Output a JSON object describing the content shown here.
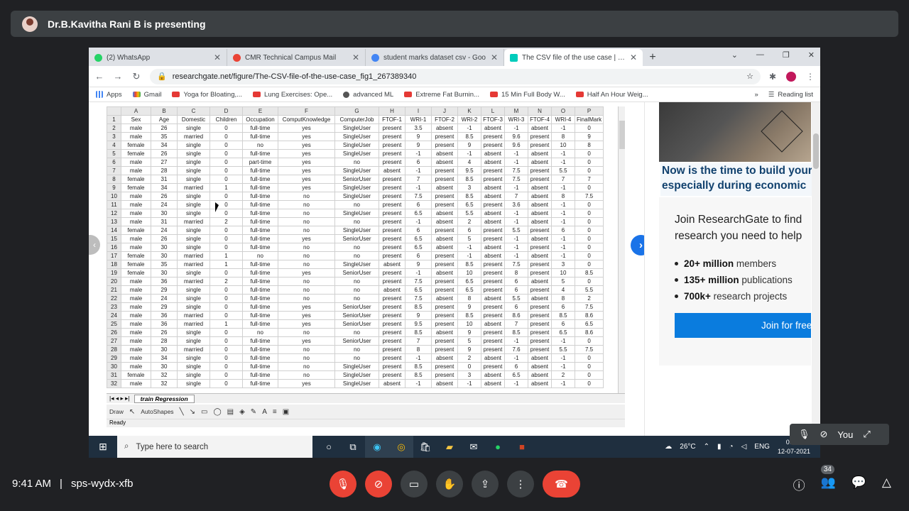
{
  "meet": {
    "presenter_label": "Dr.B.Kavitha Rani B is presenting",
    "time": "9:41 AM",
    "separator": "|",
    "meeting_code": "sps-wydx-xfb",
    "self_label": "You",
    "participants_count": "34"
  },
  "browser": {
    "tabs": [
      {
        "label": "(2) WhatsApp",
        "color": "#25d366"
      },
      {
        "label": "CMR Technical Campus Mail",
        "color": "#ea4335"
      },
      {
        "label": "student marks dataset csv - Goo",
        "color": "#4285f4"
      },
      {
        "label": "The CSV file of the use case | Da",
        "color": "#00ccbb"
      }
    ],
    "url": "researchgate.net/figure/The-CSV-file-of-the-use-case_fig1_267389340",
    "bookmarks": [
      "Apps",
      "Gmail",
      "Yoga for Bloating,...",
      "Lung Exercises: Ope...",
      "advanced ML",
      "Extreme Fat Burnin...",
      "15 Min Full Body W...",
      "Half An Hour Weig..."
    ],
    "reading_list": "Reading list",
    "more": "»"
  },
  "sheet": {
    "columns": [
      "",
      "A",
      "B",
      "C",
      "D",
      "E",
      "F",
      "G",
      "H",
      "I",
      "J",
      "K",
      "L",
      "M",
      "N",
      "O",
      "P"
    ],
    "rows": [
      [
        "1",
        "Sex",
        "Age",
        "Domestic",
        "Children",
        "Occupation",
        "ComputKnowledge",
        "ComputerJob",
        "FTOF-1",
        "WRI-1",
        "FTOF-2",
        "WRI-2",
        "FTOF-3",
        "WRI-3",
        "FTOF-4",
        "WRI-4",
        "FinalMark"
      ],
      [
        "2",
        "male",
        "26",
        "single",
        "0",
        "full-time",
        "yes",
        "SingleUser",
        "present",
        "3.5",
        "absent",
        "-1",
        "absent",
        "-1",
        "absent",
        "-1",
        "0"
      ],
      [
        "3",
        "male",
        "35",
        "married",
        "0",
        "full-time",
        "yes",
        "SingleUser",
        "present",
        "9",
        "present",
        "8.5",
        "present",
        "9.6",
        "present",
        "8",
        "9"
      ],
      [
        "4",
        "female",
        "34",
        "single",
        "0",
        "no",
        "yes",
        "SingleUser",
        "present",
        "9",
        "present",
        "9",
        "present",
        "9.6",
        "present",
        "10",
        "8"
      ],
      [
        "5",
        "female",
        "26",
        "single",
        "0",
        "full-time",
        "yes",
        "SingleUser",
        "present",
        "-1",
        "absent",
        "-1",
        "absent",
        "-1",
        "absent",
        "-1",
        "0"
      ],
      [
        "6",
        "male",
        "27",
        "single",
        "0",
        "part-time",
        "yes",
        "no",
        "present",
        "6",
        "absent",
        "4",
        "absent",
        "-1",
        "absent",
        "-1",
        "0"
      ],
      [
        "7",
        "male",
        "28",
        "single",
        "0",
        "full-time",
        "yes",
        "SingleUser",
        "absent",
        "-1",
        "present",
        "9.5",
        "present",
        "7.5",
        "present",
        "5.5",
        "0"
      ],
      [
        "8",
        "female",
        "31",
        "single",
        "0",
        "full-time",
        "yes",
        "SeniorUser",
        "present",
        "7",
        "present",
        "8.5",
        "present",
        "7.5",
        "present",
        "7",
        "7"
      ],
      [
        "9",
        "female",
        "34",
        "married",
        "1",
        "full-time",
        "yes",
        "SingleUser",
        "present",
        "-1",
        "absent",
        "3",
        "absent",
        "-1",
        "absent",
        "-1",
        "0"
      ],
      [
        "10",
        "male",
        "26",
        "single",
        "0",
        "full-time",
        "no",
        "SingleUser",
        "present",
        "7.5",
        "present",
        "8.5",
        "absent",
        "7",
        "absent",
        "8",
        "7.5"
      ],
      [
        "11",
        "male",
        "24",
        "single",
        "0",
        "full-time",
        "no",
        "no",
        "present",
        "6",
        "present",
        "6.5",
        "present",
        "3.6",
        "absent",
        "-1",
        "0"
      ],
      [
        "12",
        "male",
        "30",
        "single",
        "0",
        "full-time",
        "no",
        "SingleUser",
        "present",
        "6.5",
        "absent",
        "5.5",
        "absent",
        "-1",
        "absent",
        "-1",
        "0"
      ],
      [
        "13",
        "male",
        "31",
        "married",
        "2",
        "full-time",
        "no",
        "no",
        "present",
        "-1",
        "absent",
        "2",
        "absent",
        "-1",
        "absent",
        "-1",
        "0"
      ],
      [
        "14",
        "female",
        "24",
        "single",
        "0",
        "full-time",
        "no",
        "SingleUser",
        "present",
        "6",
        "present",
        "6",
        "present",
        "5.5",
        "present",
        "6",
        "0"
      ],
      [
        "15",
        "male",
        "26",
        "single",
        "0",
        "full-time",
        "yes",
        "SeniorUser",
        "present",
        "6.5",
        "absent",
        "5",
        "present",
        "-1",
        "absent",
        "-1",
        "0"
      ],
      [
        "16",
        "male",
        "30",
        "single",
        "0",
        "full-time",
        "no",
        "no",
        "present",
        "6.5",
        "absent",
        "-1",
        "absent",
        "-1",
        "present",
        "-1",
        "0"
      ],
      [
        "17",
        "female",
        "30",
        "married",
        "1",
        "no",
        "no",
        "no",
        "present",
        "6",
        "present",
        "-1",
        "absent",
        "-1",
        "absent",
        "-1",
        "0"
      ],
      [
        "18",
        "female",
        "35",
        "married",
        "1",
        "full-time",
        "no",
        "SingleUser",
        "absent",
        "9",
        "present",
        "8.5",
        "present",
        "7.5",
        "present",
        "3",
        "0"
      ],
      [
        "19",
        "female",
        "30",
        "single",
        "0",
        "full-time",
        "yes",
        "SeniorUser",
        "present",
        "-1",
        "absent",
        "10",
        "present",
        "8",
        "present",
        "10",
        "8.5"
      ],
      [
        "20",
        "male",
        "36",
        "married",
        "2",
        "full-time",
        "no",
        "no",
        "present",
        "7.5",
        "present",
        "6.5",
        "present",
        "6",
        "absent",
        "5",
        "0"
      ],
      [
        "21",
        "male",
        "29",
        "single",
        "0",
        "full-time",
        "no",
        "no",
        "absent",
        "6.5",
        "present",
        "6.5",
        "present",
        "6",
        "present",
        "4",
        "5.5"
      ],
      [
        "22",
        "male",
        "24",
        "single",
        "0",
        "full-time",
        "no",
        "no",
        "present",
        "7.5",
        "absent",
        "8",
        "absent",
        "5.5",
        "absent",
        "8",
        "2"
      ],
      [
        "23",
        "male",
        "29",
        "single",
        "0",
        "full-time",
        "yes",
        "SeniorUser",
        "present",
        "8.5",
        "present",
        "9",
        "present",
        "6",
        "present",
        "6",
        "7.5"
      ],
      [
        "24",
        "male",
        "36",
        "married",
        "0",
        "full-time",
        "yes",
        "SeniorUser",
        "present",
        "9",
        "present",
        "8.5",
        "present",
        "8.6",
        "present",
        "8.5",
        "8.6"
      ],
      [
        "25",
        "male",
        "36",
        "married",
        "1",
        "full-time",
        "yes",
        "SeniorUser",
        "present",
        "9.5",
        "present",
        "10",
        "absent",
        "7",
        "present",
        "6",
        "6.5"
      ],
      [
        "26",
        "male",
        "26",
        "single",
        "0",
        "no",
        "no",
        "no",
        "present",
        "8.5",
        "absent",
        "9",
        "present",
        "8.5",
        "present",
        "6.5",
        "8.6"
      ],
      [
        "27",
        "male",
        "28",
        "single",
        "0",
        "full-time",
        "yes",
        "SeniorUser",
        "present",
        "7",
        "present",
        "5",
        "present",
        "-1",
        "present",
        "-1",
        "0"
      ],
      [
        "28",
        "male",
        "30",
        "married",
        "0",
        "full-time",
        "no",
        "no",
        "present",
        "8",
        "present",
        "9",
        "present",
        "7.6",
        "present",
        "5.5",
        "7.5"
      ],
      [
        "29",
        "male",
        "34",
        "single",
        "0",
        "full-time",
        "no",
        "no",
        "present",
        "-1",
        "absent",
        "2",
        "absent",
        "-1",
        "absent",
        "-1",
        "0"
      ],
      [
        "30",
        "male",
        "30",
        "single",
        "0",
        "full-time",
        "no",
        "SingleUser",
        "present",
        "8.5",
        "present",
        "0",
        "present",
        "6",
        "absent",
        "-1",
        "0"
      ],
      [
        "31",
        "female",
        "32",
        "single",
        "0",
        "full-time",
        "no",
        "SingleUser",
        "present",
        "8.5",
        "present",
        "3",
        "absent",
        "6.5",
        "absent",
        "2",
        "0"
      ],
      [
        "32",
        "male",
        "32",
        "single",
        "0",
        "full-time",
        "yes",
        "SingleUser",
        "absent",
        "-1",
        "absent",
        "-1",
        "absent",
        "-1",
        "absent",
        "-1",
        "0"
      ]
    ],
    "sheet_tab": "train Regression",
    "draw_label": "Draw",
    "autoshapes_label": "AutoShapes",
    "status": "Ready"
  },
  "ad": {
    "headline_1": "Now is the time to build your",
    "headline_2": "especially during economic"
  },
  "join": {
    "title_1": "Join ResearchGate to find",
    "title_2": "research you need to help",
    "stats": [
      {
        "bold": "20+ million",
        "rest": " members"
      },
      {
        "bold": "135+ million",
        "rest": " publications"
      },
      {
        "bold": "700k+",
        "rest": " research projects"
      }
    ],
    "button": "Join for free"
  },
  "taskbar": {
    "search_placeholder": "Type here to search",
    "weather": "26°C",
    "lang": "ENG",
    "time": "09:41",
    "date": "12-07-2021"
  }
}
